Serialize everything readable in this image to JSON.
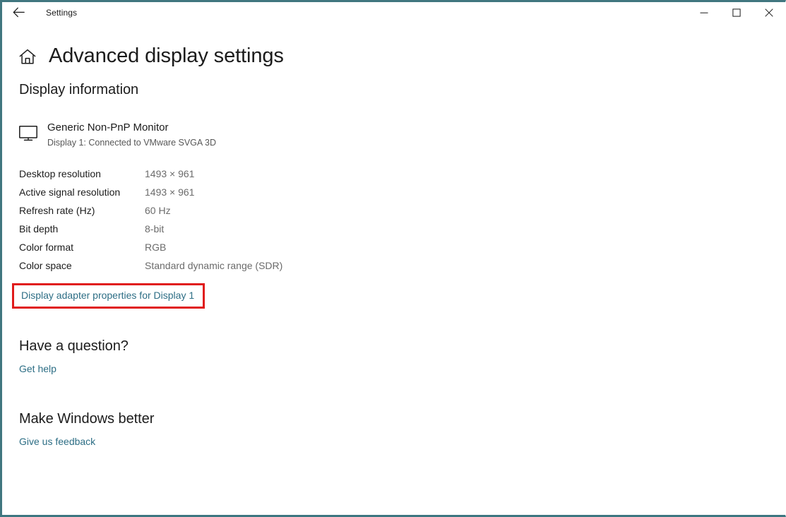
{
  "window": {
    "titlebar": {
      "title": "Settings",
      "back_icon": "back-arrow-icon",
      "minimize_label": "Minimize",
      "maximize_label": "Maximize",
      "close_label": "Close"
    },
    "accent_color": "#41767f"
  },
  "header": {
    "home_icon": "home-icon",
    "title": "Advanced display settings"
  },
  "main": {
    "display_information": {
      "heading": "Display information",
      "monitor": {
        "icon": "monitor-icon",
        "name": "Generic Non-PnP Monitor",
        "subtitle": "Display 1: Connected to VMware SVGA 3D"
      },
      "rows": [
        {
          "label": "Desktop resolution",
          "value": "1493 × 961"
        },
        {
          "label": "Active signal resolution",
          "value": "1493 × 961"
        },
        {
          "label": "Refresh rate (Hz)",
          "value": "60 Hz"
        },
        {
          "label": "Bit depth",
          "value": "8-bit"
        },
        {
          "label": "Color format",
          "value": "RGB"
        },
        {
          "label": "Color space",
          "value": "Standard dynamic range (SDR)"
        }
      ],
      "adapter_link": "Display adapter properties for Display 1",
      "highlight_color": "#e01b1b"
    },
    "have_a_question": {
      "heading": "Have a question?",
      "link": "Get help"
    },
    "make_windows_better": {
      "heading": "Make Windows better",
      "link": "Give us feedback"
    },
    "link_color": "#2d6e85"
  }
}
